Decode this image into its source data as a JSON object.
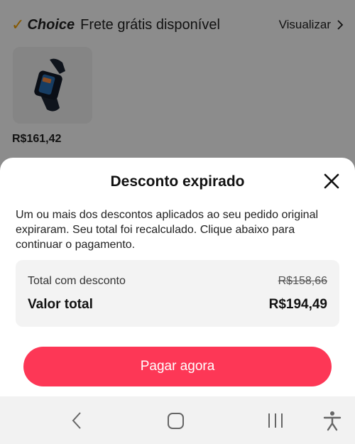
{
  "header": {
    "choice_check": "✓",
    "choice_word": "Choice",
    "shipping_text": "Frete grátis disponível",
    "view_label": "Visualizar"
  },
  "product": {
    "price": "R$161,42"
  },
  "dialog": {
    "title": "Desconto expirado",
    "message": "Um ou mais dos descontos aplicados ao seu pedido original expiraram. Seu total foi recalculado. Clique abaixo para continuar o pagamento.",
    "discount_label": "Total com desconto",
    "discount_value": "R$158,66",
    "total_label": "Valor total",
    "total_value": "R$194,49",
    "pay_button": "Pagar agora"
  },
  "colors": {
    "accent": "#fd3756",
    "choice": "#f2a000"
  },
  "navbar": {
    "icons": [
      "back-icon",
      "home-icon",
      "recents-icon",
      "accessibility-icon"
    ]
  }
}
